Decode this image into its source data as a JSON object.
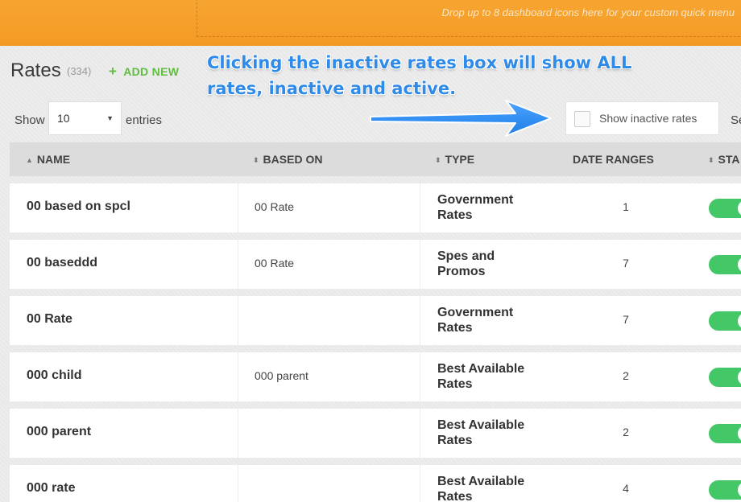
{
  "topbar": {
    "drop_hint": "Drop up to 8 dashboard icons here for your custom quick menu"
  },
  "header": {
    "title": "Rates",
    "count": "(334)",
    "add_new_icon": "plus-icon",
    "add_new_label": "ADD NEW"
  },
  "annotation": {
    "text": "Clicking the inactive rates box will show ALL rates, inactive and active.",
    "color": "#2f8ae8"
  },
  "controls": {
    "show_label": "Show",
    "page_size": "10",
    "entries_label": "entries",
    "inactive_label": "Show inactive rates",
    "inactive_checked": false,
    "search_label": "Se"
  },
  "table": {
    "columns": [
      {
        "label": "NAME",
        "sort_icon": "sort-asc-icon"
      },
      {
        "label": "BASED ON",
        "sort_icon": "sort-both-icon"
      },
      {
        "label": "TYPE",
        "sort_icon": "sort-both-icon"
      },
      {
        "label": "DATE RANGES",
        "sort_icon": ""
      },
      {
        "label": "STA",
        "sort_icon": "sort-both-icon"
      }
    ],
    "rows": [
      {
        "name": "00 based on spcl",
        "based_on": "00 Rate",
        "type_line1": "Government",
        "type_line2": "Rates",
        "date_ranges": "1",
        "status": "active"
      },
      {
        "name": "00 baseddd",
        "based_on": "00 Rate",
        "type_line1": "Spes and",
        "type_line2": "Promos",
        "date_ranges": "7",
        "status": "active"
      },
      {
        "name": "00 Rate",
        "based_on": "",
        "type_line1": "Government",
        "type_line2": "Rates",
        "date_ranges": "7",
        "status": "active"
      },
      {
        "name": "000 child",
        "based_on": "000 parent",
        "type_line1": "Best Available",
        "type_line2": "Rates",
        "date_ranges": "2",
        "status": "active"
      },
      {
        "name": "000 parent",
        "based_on": "",
        "type_line1": "Best Available",
        "type_line2": "Rates",
        "date_ranges": "2",
        "status": "active"
      },
      {
        "name": "000 rate",
        "based_on": "",
        "type_line1": "Best Available",
        "type_line2": "Rates",
        "date_ranges": "4",
        "status": "active"
      }
    ]
  },
  "colors": {
    "topbar": "#f39a24",
    "add_new": "#5fbd3f",
    "toggle_on": "#44c767"
  }
}
